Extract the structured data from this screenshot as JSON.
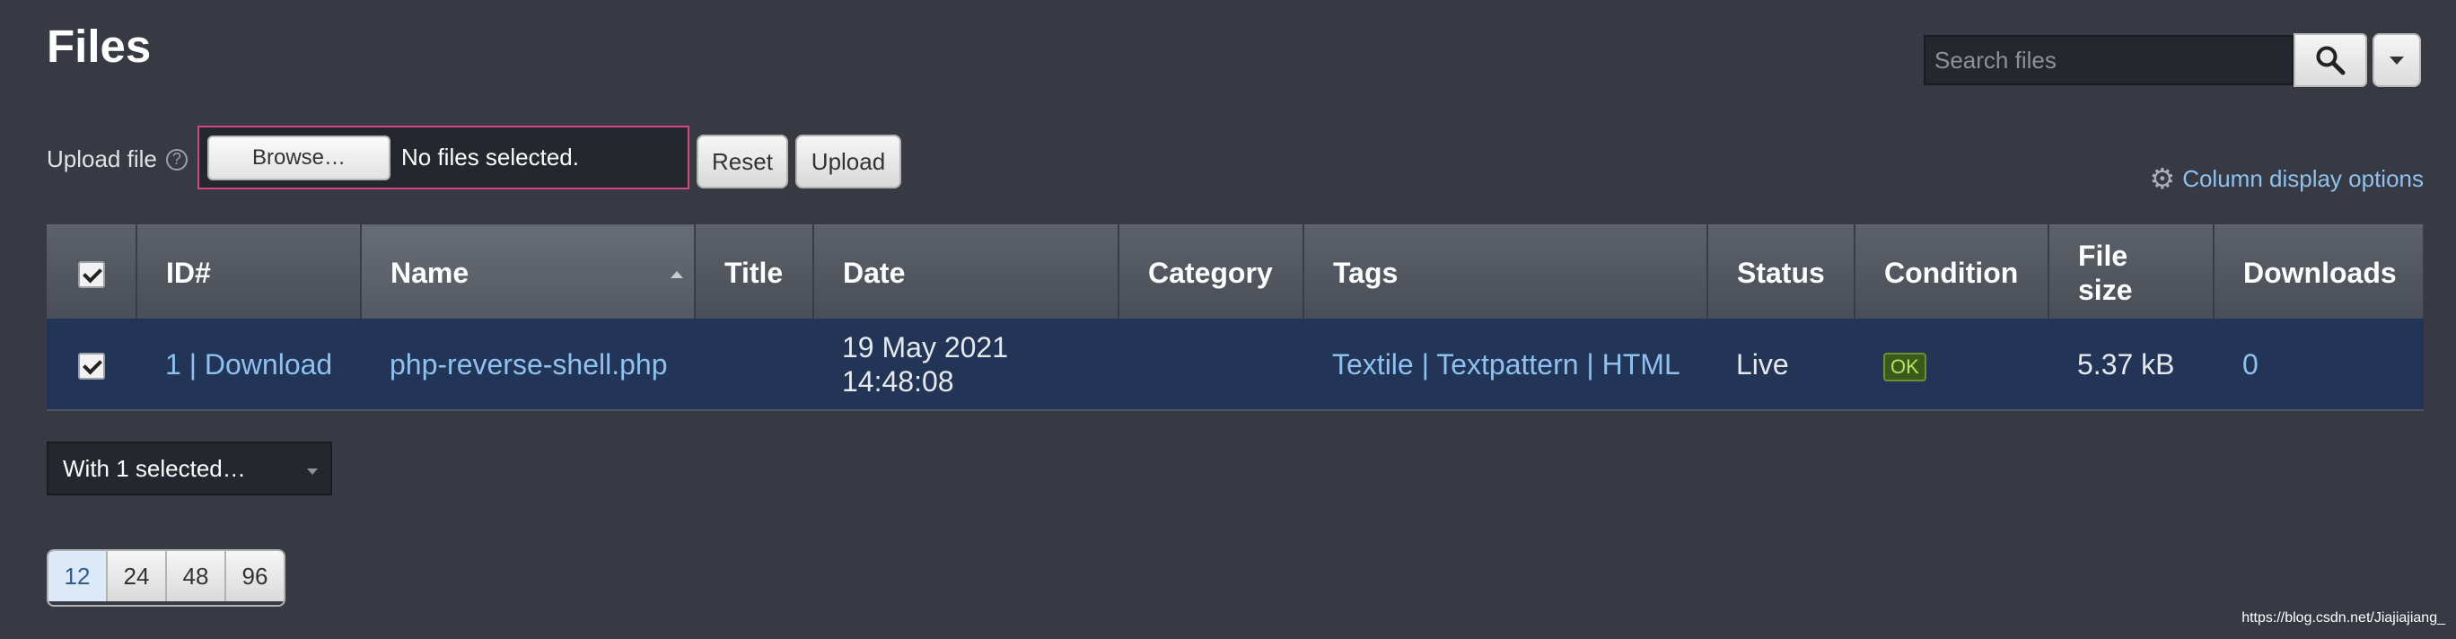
{
  "page": {
    "title": "Files"
  },
  "search": {
    "placeholder": "Search files"
  },
  "upload": {
    "label": "Upload file",
    "help_icon": "?",
    "browse_label": "Browse…",
    "status_text": "No files selected.",
    "reset_label": "Reset",
    "upload_label": "Upload"
  },
  "column_options": {
    "label": "Column display options",
    "icon": "gear-icon"
  },
  "table": {
    "headers": {
      "id": "ID#",
      "name": "Name",
      "title": "Title",
      "date": "Date",
      "category": "Category",
      "tags": "Tags",
      "status": "Status",
      "condition": "Condition",
      "file_size_line1": "File",
      "file_size_line2": "size",
      "downloads": "Downloads"
    },
    "sorted_column": "Name",
    "rows": [
      {
        "selected": true,
        "id": "1",
        "id_sep": "|",
        "download": "Download",
        "name": "php-reverse-shell.php",
        "title": "",
        "date_line1": "19 May 2021",
        "date_line2": "14:48:08",
        "category": "",
        "tags": [
          "Textile",
          "Textpattern",
          "HTML"
        ],
        "tag_sep": "|",
        "status": "Live",
        "condition": "OK",
        "file_size": "5.37 kB",
        "downloads": "0"
      }
    ]
  },
  "bulk_action": {
    "label": "With 1 selected…"
  },
  "pagination": {
    "options": [
      "12",
      "24",
      "48",
      "96"
    ],
    "active": "12"
  },
  "watermark": "https://blog.csdn.net/Jiajiajiang_",
  "colors": {
    "background": "#373a43",
    "selected_row": "#223556",
    "link": "#8ec1ee",
    "file_input_border": "#d2477f",
    "ok_badge": "#b7e05b"
  }
}
